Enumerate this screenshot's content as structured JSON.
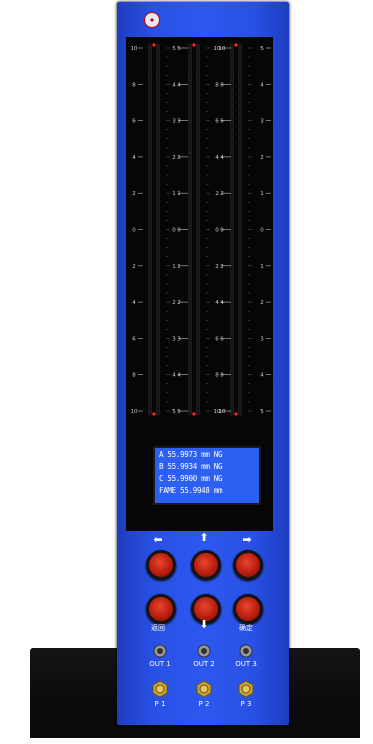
{
  "buttons": {
    "left_icon": "arrow-left",
    "up_icon": "arrow-up",
    "right_icon": "arrow-right",
    "down_icon": "arrow-down",
    "back_label": "返回",
    "confirm_label": "确定"
  },
  "lcd": {
    "row_a": "A  55.9973 mm  NG",
    "row_b": "B  55.9934 mm  NG",
    "row_c": "C  55.9900 mm  NG",
    "row_d": "FAME 55.9948 mm"
  },
  "outputs": [
    "OUT 1",
    "OUT 2",
    "OUT 3"
  ],
  "ports": [
    "P 1",
    "P 2",
    "P 3"
  ],
  "gauge_ticks": {
    "left": [
      "10",
      "8",
      "6",
      "4",
      "2",
      "0",
      "2",
      "4",
      "6",
      "8",
      "10"
    ],
    "mid": [
      "5",
      "4",
      "3",
      "2",
      "1",
      "0",
      "1",
      "2",
      "3",
      "4",
      "5"
    ],
    "right": [
      "10",
      "8",
      "6",
      "4",
      "2",
      "0",
      "2",
      "4",
      "6",
      "8",
      "10"
    ]
  },
  "colors": {
    "body": "#2d58ef",
    "button": "#c8281a",
    "lcd": "#2d60f0"
  }
}
